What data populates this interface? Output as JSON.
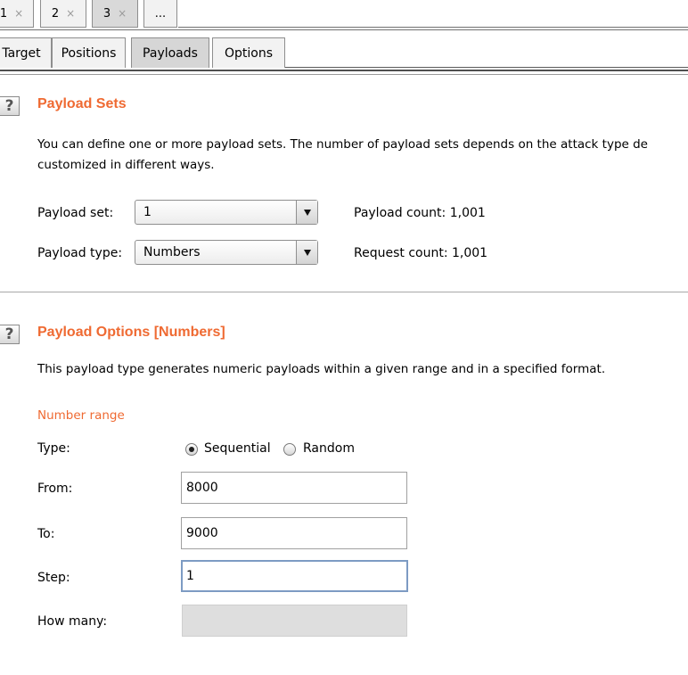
{
  "attack_tabs": [
    {
      "label": "1",
      "close": "×"
    },
    {
      "label": "2",
      "close": "×"
    },
    {
      "label": "3",
      "close": "×"
    },
    {
      "label": "..."
    }
  ],
  "sub_tabs": [
    "Target",
    "Positions",
    "Payloads",
    "Options"
  ],
  "payload_sets": {
    "help": "?",
    "title": "Payload Sets",
    "description_line1": "You can define one or more payload sets. The number of payload sets depends on the attack type de",
    "description_line2": "customized in different ways.",
    "set_label": "Payload set:",
    "set_value": "1",
    "type_label": "Payload type:",
    "type_value": "Numbers",
    "payload_count": "Payload count:  1,001",
    "request_count": "Request count:  1,001"
  },
  "payload_options": {
    "help": "?",
    "title": "Payload Options [Numbers]",
    "description": "This payload type generates numeric payloads within a given range and in a specified format.",
    "number_range_heading": "Number range",
    "type_label": "Type:",
    "sequential_label": "Sequential",
    "random_label": "Random",
    "from_label": "From:",
    "from_value": "8000",
    "to_label": "To:",
    "to_value": "9000",
    "step_label": "Step:",
    "step_value": "1",
    "how_many_label": "How many:",
    "how_many_value": ""
  },
  "colors": {
    "accent": "#ef6a32",
    "focus_border": "#7d9bc3"
  }
}
